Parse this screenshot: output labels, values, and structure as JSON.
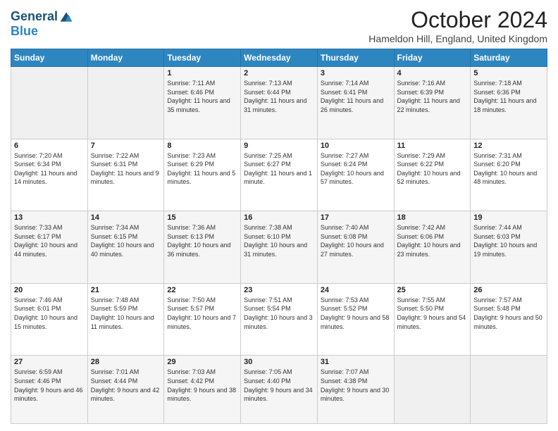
{
  "header": {
    "logo_line1": "General",
    "logo_line2": "Blue",
    "month_title": "October 2024",
    "location": "Hameldon Hill, England, United Kingdom"
  },
  "days_of_week": [
    "Sunday",
    "Monday",
    "Tuesday",
    "Wednesday",
    "Thursday",
    "Friday",
    "Saturday"
  ],
  "weeks": [
    [
      {
        "day": "",
        "sunrise": "",
        "sunset": "",
        "daylight": ""
      },
      {
        "day": "",
        "sunrise": "",
        "sunset": "",
        "daylight": ""
      },
      {
        "day": "1",
        "sunrise": "Sunrise: 7:11 AM",
        "sunset": "Sunset: 6:46 PM",
        "daylight": "Daylight: 11 hours and 35 minutes."
      },
      {
        "day": "2",
        "sunrise": "Sunrise: 7:13 AM",
        "sunset": "Sunset: 6:44 PM",
        "daylight": "Daylight: 11 hours and 31 minutes."
      },
      {
        "day": "3",
        "sunrise": "Sunrise: 7:14 AM",
        "sunset": "Sunset: 6:41 PM",
        "daylight": "Daylight: 11 hours and 26 minutes."
      },
      {
        "day": "4",
        "sunrise": "Sunrise: 7:16 AM",
        "sunset": "Sunset: 6:39 PM",
        "daylight": "Daylight: 11 hours and 22 minutes."
      },
      {
        "day": "5",
        "sunrise": "Sunrise: 7:18 AM",
        "sunset": "Sunset: 6:36 PM",
        "daylight": "Daylight: 11 hours and 18 minutes."
      }
    ],
    [
      {
        "day": "6",
        "sunrise": "Sunrise: 7:20 AM",
        "sunset": "Sunset: 6:34 PM",
        "daylight": "Daylight: 11 hours and 14 minutes."
      },
      {
        "day": "7",
        "sunrise": "Sunrise: 7:22 AM",
        "sunset": "Sunset: 6:31 PM",
        "daylight": "Daylight: 11 hours and 9 minutes."
      },
      {
        "day": "8",
        "sunrise": "Sunrise: 7:23 AM",
        "sunset": "Sunset: 6:29 PM",
        "daylight": "Daylight: 11 hours and 5 minutes."
      },
      {
        "day": "9",
        "sunrise": "Sunrise: 7:25 AM",
        "sunset": "Sunset: 6:27 PM",
        "daylight": "Daylight: 11 hours and 1 minute."
      },
      {
        "day": "10",
        "sunrise": "Sunrise: 7:27 AM",
        "sunset": "Sunset: 6:24 PM",
        "daylight": "Daylight: 10 hours and 57 minutes."
      },
      {
        "day": "11",
        "sunrise": "Sunrise: 7:29 AM",
        "sunset": "Sunset: 6:22 PM",
        "daylight": "Daylight: 10 hours and 52 minutes."
      },
      {
        "day": "12",
        "sunrise": "Sunrise: 7:31 AM",
        "sunset": "Sunset: 6:20 PM",
        "daylight": "Daylight: 10 hours and 48 minutes."
      }
    ],
    [
      {
        "day": "13",
        "sunrise": "Sunrise: 7:33 AM",
        "sunset": "Sunset: 6:17 PM",
        "daylight": "Daylight: 10 hours and 44 minutes."
      },
      {
        "day": "14",
        "sunrise": "Sunrise: 7:34 AM",
        "sunset": "Sunset: 6:15 PM",
        "daylight": "Daylight: 10 hours and 40 minutes."
      },
      {
        "day": "15",
        "sunrise": "Sunrise: 7:36 AM",
        "sunset": "Sunset: 6:13 PM",
        "daylight": "Daylight: 10 hours and 36 minutes."
      },
      {
        "day": "16",
        "sunrise": "Sunrise: 7:38 AM",
        "sunset": "Sunset: 6:10 PM",
        "daylight": "Daylight: 10 hours and 31 minutes."
      },
      {
        "day": "17",
        "sunrise": "Sunrise: 7:40 AM",
        "sunset": "Sunset: 6:08 PM",
        "daylight": "Daylight: 10 hours and 27 minutes."
      },
      {
        "day": "18",
        "sunrise": "Sunrise: 7:42 AM",
        "sunset": "Sunset: 6:06 PM",
        "daylight": "Daylight: 10 hours and 23 minutes."
      },
      {
        "day": "19",
        "sunrise": "Sunrise: 7:44 AM",
        "sunset": "Sunset: 6:03 PM",
        "daylight": "Daylight: 10 hours and 19 minutes."
      }
    ],
    [
      {
        "day": "20",
        "sunrise": "Sunrise: 7:46 AM",
        "sunset": "Sunset: 6:01 PM",
        "daylight": "Daylight: 10 hours and 15 minutes."
      },
      {
        "day": "21",
        "sunrise": "Sunrise: 7:48 AM",
        "sunset": "Sunset: 5:59 PM",
        "daylight": "Daylight: 10 hours and 11 minutes."
      },
      {
        "day": "22",
        "sunrise": "Sunrise: 7:50 AM",
        "sunset": "Sunset: 5:57 PM",
        "daylight": "Daylight: 10 hours and 7 minutes."
      },
      {
        "day": "23",
        "sunrise": "Sunrise: 7:51 AM",
        "sunset": "Sunset: 5:54 PM",
        "daylight": "Daylight: 10 hours and 3 minutes."
      },
      {
        "day": "24",
        "sunrise": "Sunrise: 7:53 AM",
        "sunset": "Sunset: 5:52 PM",
        "daylight": "Daylight: 9 hours and 58 minutes."
      },
      {
        "day": "25",
        "sunrise": "Sunrise: 7:55 AM",
        "sunset": "Sunset: 5:50 PM",
        "daylight": "Daylight: 9 hours and 54 minutes."
      },
      {
        "day": "26",
        "sunrise": "Sunrise: 7:57 AM",
        "sunset": "Sunset: 5:48 PM",
        "daylight": "Daylight: 9 hours and 50 minutes."
      }
    ],
    [
      {
        "day": "27",
        "sunrise": "Sunrise: 6:59 AM",
        "sunset": "Sunset: 4:46 PM",
        "daylight": "Daylight: 9 hours and 46 minutes."
      },
      {
        "day": "28",
        "sunrise": "Sunrise: 7:01 AM",
        "sunset": "Sunset: 4:44 PM",
        "daylight": "Daylight: 9 hours and 42 minutes."
      },
      {
        "day": "29",
        "sunrise": "Sunrise: 7:03 AM",
        "sunset": "Sunset: 4:42 PM",
        "daylight": "Daylight: 9 hours and 38 minutes."
      },
      {
        "day": "30",
        "sunrise": "Sunrise: 7:05 AM",
        "sunset": "Sunset: 4:40 PM",
        "daylight": "Daylight: 9 hours and 34 minutes."
      },
      {
        "day": "31",
        "sunrise": "Sunrise: 7:07 AM",
        "sunset": "Sunset: 4:38 PM",
        "daylight": "Daylight: 9 hours and 30 minutes."
      },
      {
        "day": "",
        "sunrise": "",
        "sunset": "",
        "daylight": ""
      },
      {
        "day": "",
        "sunrise": "",
        "sunset": "",
        "daylight": ""
      }
    ]
  ]
}
